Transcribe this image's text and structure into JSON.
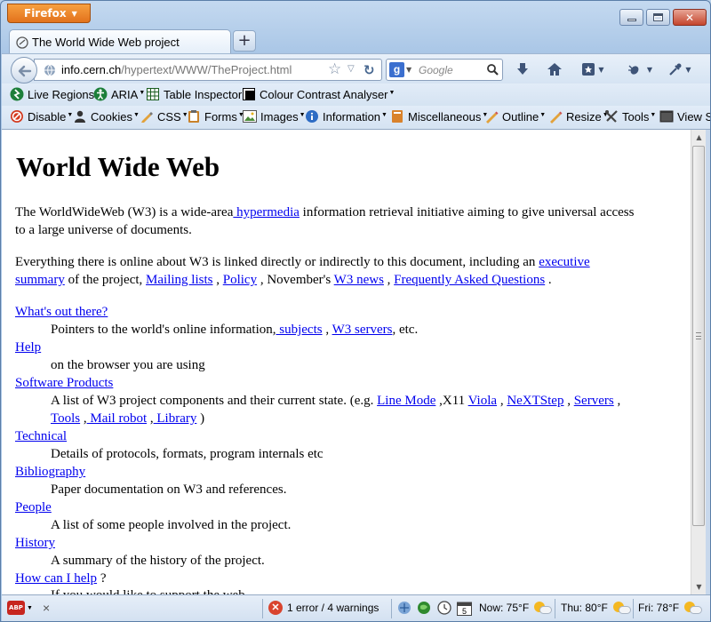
{
  "browser": {
    "app_button_label": "Firefox",
    "tab_title": "The World Wide Web project",
    "new_tab_label": "+",
    "url_host": "info.cern.ch",
    "url_path": "/hypertext/WWW/TheProject.html",
    "search_placeholder": "Google"
  },
  "bookmarks": [
    {
      "label": "Live Regions",
      "icon": "live-regions-icon"
    },
    {
      "label": "ARIA",
      "icon": "accessibility-person-icon"
    },
    {
      "label": "Table Inspector",
      "icon": "table-grid-icon"
    },
    {
      "label": "Colour Contrast Analyser",
      "icon": "contrast-square-icon"
    }
  ],
  "webdev_toolbar": [
    {
      "label": "Disable",
      "icon": "disable-icon"
    },
    {
      "label": "Cookies",
      "icon": "cookies-icon"
    },
    {
      "label": "CSS",
      "icon": "css-pencil-icon"
    },
    {
      "label": "Forms",
      "icon": "forms-clipboard-icon"
    },
    {
      "label": "Images",
      "icon": "images-icon"
    },
    {
      "label": "Information",
      "icon": "information-icon"
    },
    {
      "label": "Miscellaneous",
      "icon": "miscellaneous-icon"
    },
    {
      "label": "Outline",
      "icon": "outline-pencil-icon"
    },
    {
      "label": "Resize",
      "icon": "resize-pencil-icon"
    },
    {
      "label": "Tools",
      "icon": "tools-icon"
    },
    {
      "label": "View S",
      "icon": "view-source-icon"
    }
  ],
  "page": {
    "heading": "World Wide Web",
    "intro": {
      "t1": "The WorldWideWeb (W3) is a wide-area",
      "link_hypermedia": " hypermedia",
      "t2": " information retrieval initiative aiming to give universal access",
      "t3": "to a large universe of documents."
    },
    "para2": {
      "t1": "Everything there is online about W3 is linked directly or indirectly to this document, including an ",
      "link_exec": "executive",
      "link_summary": "summary",
      "t2": " of the project, ",
      "link_mailing": "Mailing lists",
      "t3": " , ",
      "link_policy": "Policy",
      "t4": " , November's ",
      "link_news": "W3 news",
      "t5": " , ",
      "link_faq": "Frequently Asked Questions",
      "t6": " ."
    },
    "items": {
      "whats_out": {
        "term": "What's out there?",
        "d1": "Pointers to the world's online information,",
        "l1": " subjects",
        "d2": " , ",
        "l2": "W3 servers",
        "d3": ", etc."
      },
      "help": {
        "term": "Help",
        "d": "on the browser you are using"
      },
      "software": {
        "term": "Software Products",
        "d1": "A list of W3 project components and their current state. (e.g. ",
        "l1": "Line Mode",
        "d2": " ,X11 ",
        "l2": "Viola",
        "d3": " , ",
        "l3": "NeXTStep",
        "d4": " , ",
        "l4": "Servers",
        "d5": " ,",
        "l5": "Tools",
        "d6": " ,",
        "l6": " Mail robot",
        "d7": " ,",
        "l7": " Library",
        "d8": " )"
      },
      "technical": {
        "term": "Technical",
        "d": "Details of protocols, formats, program internals etc"
      },
      "bibliography": {
        "term": "Bibliography",
        "d": "Paper documentation on W3 and references."
      },
      "people": {
        "term": "People",
        "d": "A list of some people involved in the project."
      },
      "history": {
        "term": "History",
        "d": "A summary of the history of the project."
      },
      "howcan": {
        "term": "How can I help",
        "after": " ?",
        "d": "If you would like to support the web.."
      }
    }
  },
  "status": {
    "abp_label": "ABP",
    "close_label": "×",
    "errors": "1 error / 4 warnings",
    "calendar_day": "5",
    "weather_now": "Now: 75°F",
    "weather_thu": "Thu: 80°F",
    "weather_fri": "Fri: 78°F"
  },
  "colors": {
    "link": "#0000ee",
    "firefox_button": "#e8801f",
    "error": "#d9442e"
  }
}
